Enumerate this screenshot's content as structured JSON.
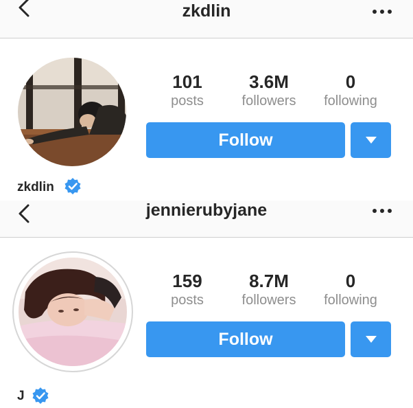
{
  "profiles": [
    {
      "username": "zkdlin",
      "display_name": "zkdlin",
      "verified": true,
      "stats": [
        {
          "value": "101",
          "label": "posts"
        },
        {
          "value": "3.6M",
          "label": "followers"
        },
        {
          "value": "0",
          "label": "following"
        }
      ],
      "follow_label": "Follow"
    },
    {
      "username": "jennierubyjane",
      "display_name": "J",
      "verified": true,
      "stats": [
        {
          "value": "159",
          "label": "posts"
        },
        {
          "value": "8.7M",
          "label": "followers"
        },
        {
          "value": "0",
          "label": "following"
        }
      ],
      "follow_label": "Follow"
    }
  ],
  "icons": {
    "back": "chevron-left-icon",
    "more": "more-dots-icon",
    "verified": "verified-badge-icon",
    "dropdown": "caret-down-icon"
  },
  "colors": {
    "accent": "#3897f0",
    "text": "#262626",
    "muted": "#8e8e8e",
    "verified": "#3897f0"
  }
}
